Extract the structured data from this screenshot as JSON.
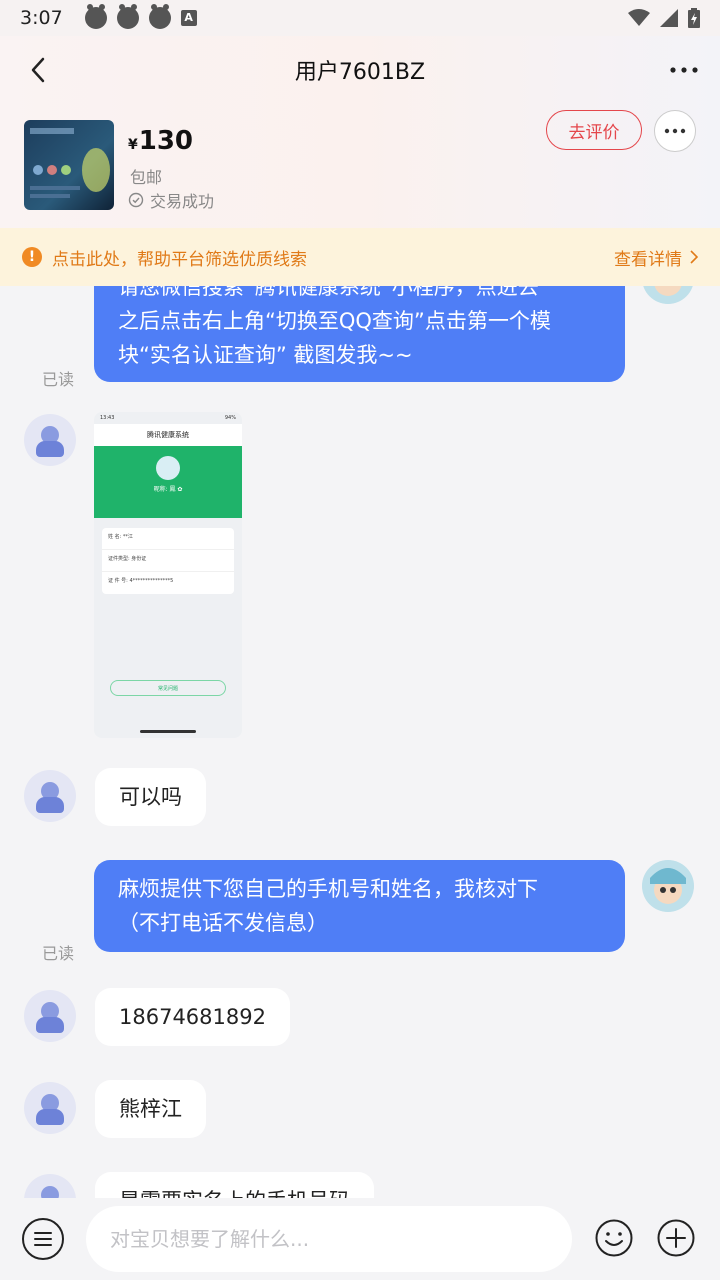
{
  "status_bar": {
    "time": "3:07",
    "app_icon": "A"
  },
  "header": {
    "title": "用户7601BZ"
  },
  "product": {
    "currency": "¥",
    "price": "130",
    "shipping": "包邮",
    "deal_status": "交易成功",
    "review_label": "去评价"
  },
  "notice": {
    "icon_label": "!",
    "text": "点击此处，帮助平台筛选优质线索",
    "detail_label": "查看详情"
  },
  "messages": {
    "m1": "请您微信搜索“腾讯健康系统”小程序，点进去之后点击右上角“切换至QQ查询”点击第一个模块“实名认证查询” 截图发我~~",
    "m1_line1": "请您微信搜索“腾讯健康系统”小程序，点进去",
    "m1_line2": "之后点击右上角“切换至QQ查询”点击第一个模",
    "m1_line3": "块“实名认证查询” 截图发我~~",
    "read1": "已读",
    "m3": "可以吗",
    "m4_line1": "麻烦提供下您自己的手机号和姓名，我核对下",
    "m4_line2": "（不打电话不发信息）",
    "read2": "已读",
    "m5": "18674681892",
    "m6": "熊梓江",
    "m7": "是需要实名上的手机号码"
  },
  "screenshot": {
    "time": "13:43",
    "battery": "94%",
    "title": "腾讯健康系统",
    "name_line": "昵称: 鳳 ✿ ",
    "row1": "姓    名:  **江",
    "row2": "证件类型:  身份证",
    "row3": "证 件 号:  4***************5",
    "button": "常见问题"
  },
  "input": {
    "placeholder": "对宝贝想要了解什么..."
  },
  "colors": {
    "accent_blue": "#4f7ef6",
    "review_red": "#e4464b",
    "notice_orange": "#e07a18"
  }
}
